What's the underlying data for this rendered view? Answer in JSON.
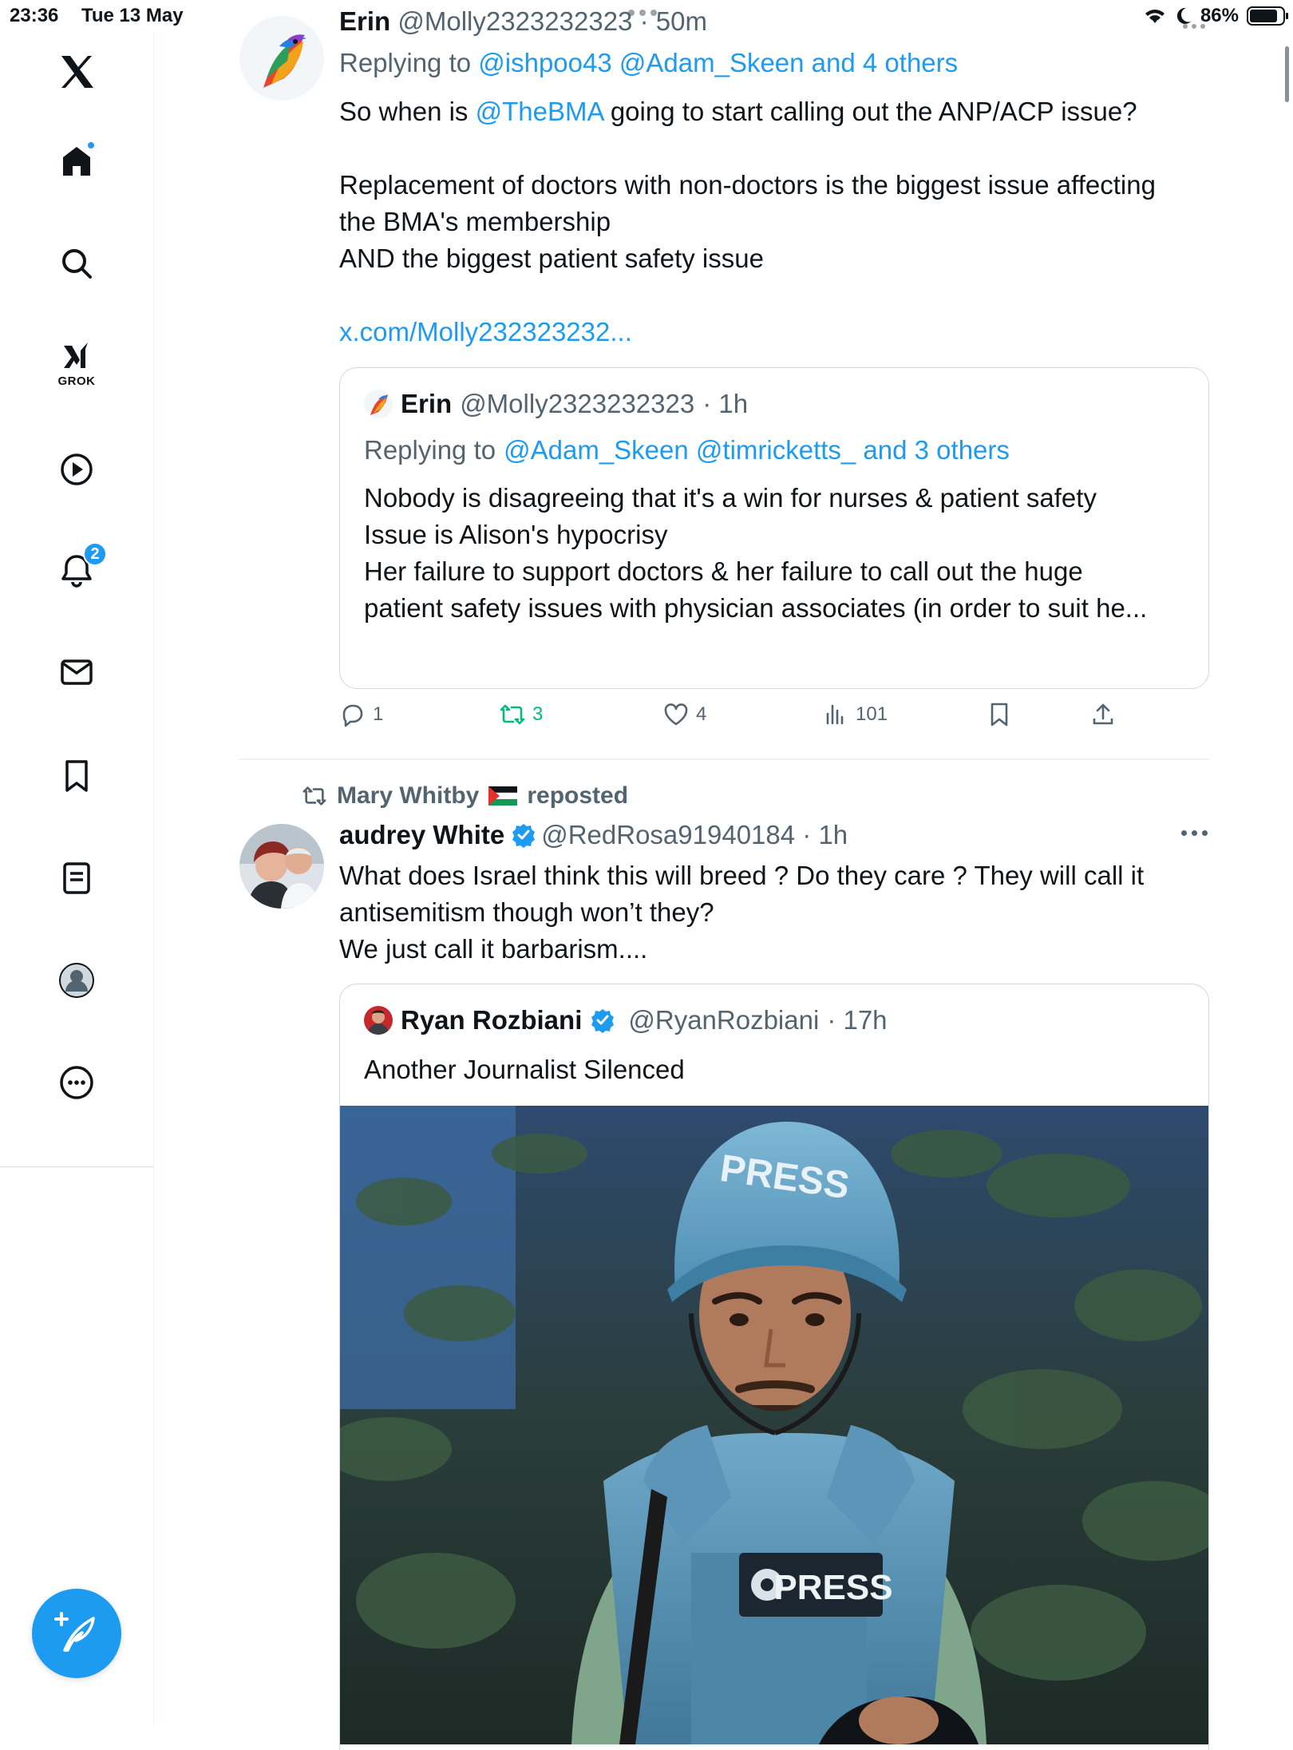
{
  "status_bar": {
    "time": "23:36",
    "date": "Tue 13 May",
    "battery_text": "86%",
    "battery_level": 0.86
  },
  "sidebar": {
    "logo_icon": "x-logo-icon",
    "grok_label": "GROK",
    "notifications_badge": "2",
    "items": [
      "home-icon",
      "search-icon",
      "grok-icon",
      "video-icon",
      "notifications-icon",
      "messages-icon",
      "bookmarks-icon",
      "lists-icon",
      "profile-icon",
      "more-icon"
    ]
  },
  "tweets": [
    {
      "name": "Erin",
      "handle": "@Molly2323232323",
      "time": "· 50m",
      "replying_prefix": "Replying to ",
      "replying_to": "@ishpoo43 @Adam_Skeen and 4 others",
      "text_pre": "So when is ",
      "mention": "@TheBMA",
      "text_post": " going to start calling out the ANP/ACP issue?",
      "para2_line1": "Replacement of doctors with non-doctors is the biggest issue affecting",
      "para2_line2": "the BMA's membership",
      "para2_line3": "AND the biggest patient safety issue",
      "link": "x.com/Molly232323232...",
      "quote": {
        "name": "Erin",
        "handle": "@Molly2323232323",
        "time": "· 1h",
        "replying_prefix": "Replying to ",
        "replying_to": "@Adam_Skeen @timricketts_ and 3 others",
        "line1": "Nobody is disagreeing that it's a win for nurses & patient safety",
        "line2": "Issue is Alison's hypocrisy",
        "line3": "Her failure to support doctors & her failure to call out the huge",
        "line4": "patient safety issues with physician associates (in order to suit he..."
      },
      "actions": {
        "replies": "1",
        "reposts": "3",
        "likes": "4",
        "views": "101"
      }
    },
    {
      "reposted_by": "Mary Whitby",
      "reposted_flag": "palestine-flag-icon",
      "reposted_label": "reposted",
      "name": "audrey White",
      "handle": "@RedRosa91940184",
      "time": "· 1h",
      "line1": "What does Israel think this will breed ? Do they care ? They will call it",
      "line2": "antisemitism though won’t they?",
      "line3": "We just call it barbarism....",
      "quote": {
        "name": "Ryan Rozbiani",
        "handle": "@RyanRozbiani",
        "time": "· 17h",
        "text": "Another Journalist Silenced",
        "photo_helmet_text": "PRESS",
        "photo_vest_text": "PRESS"
      }
    }
  ],
  "colors": {
    "accent": "#1d9bf0",
    "repost_green": "#00ba7c",
    "secondary_text": "#536471"
  }
}
